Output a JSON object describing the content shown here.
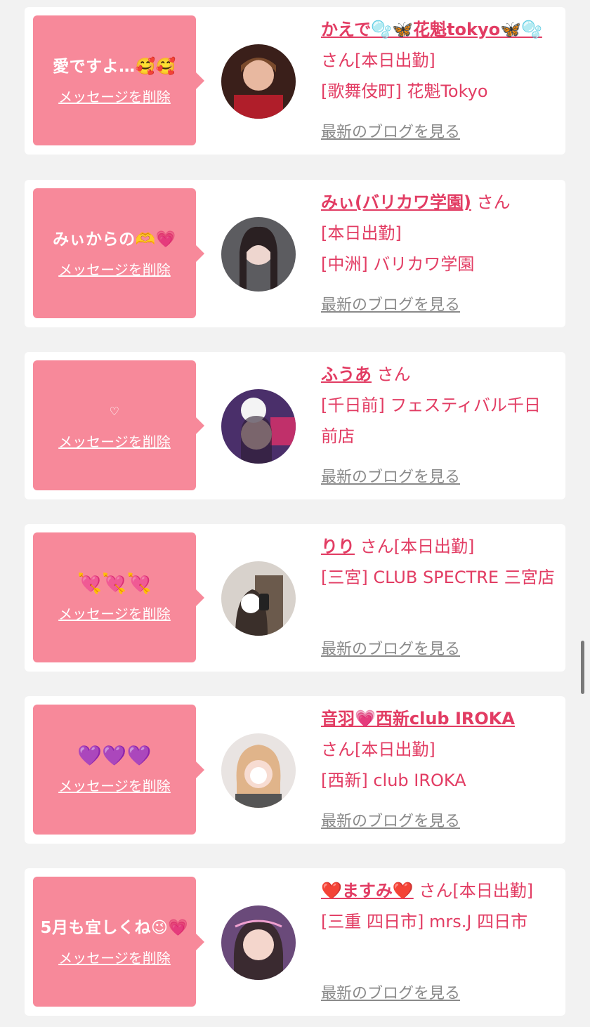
{
  "delete_label": "メッセージを削除",
  "blog_label": "最新のブログを見る",
  "san_suffix": "さん",
  "colors": {
    "accent": "#e23c63",
    "bubble": "#f7899a",
    "blog": "#8a8a8a",
    "background": "#f2f2f2"
  },
  "cards": [
    {
      "message": "愛ですよ…🥰🥰",
      "name": "かえで🫧🦋花魁tokyo🦋🫧",
      "status": "[本日出勤]",
      "shop": "[歌舞伎町] 花魁Tokyo"
    },
    {
      "message": "みぃからの🫶💗",
      "name": "みぃ(バリカワ学園)",
      "status": "[本日出勤]",
      "shop": "[中洲] バリカワ学園"
    },
    {
      "message": "♡",
      "name": "ふうあ",
      "status": "",
      "shop": "[千日前] フェスティバル千日前店"
    },
    {
      "message": "💘💘💘",
      "name": "りり",
      "status": "[本日出勤]",
      "shop": "[三宮] CLUB SPECTRE 三宮店"
    },
    {
      "message": "💜💜💜",
      "name": "音羽💗西新club IROKA",
      "status": "[本日出勤]",
      "shop": "[西新] club IROKA"
    },
    {
      "message": "5月も宜しくね😉💗",
      "name": "❤️ますみ❤️",
      "status": "[本日出勤]",
      "shop": "[三重 四日市] mrs.J 四日市"
    }
  ]
}
